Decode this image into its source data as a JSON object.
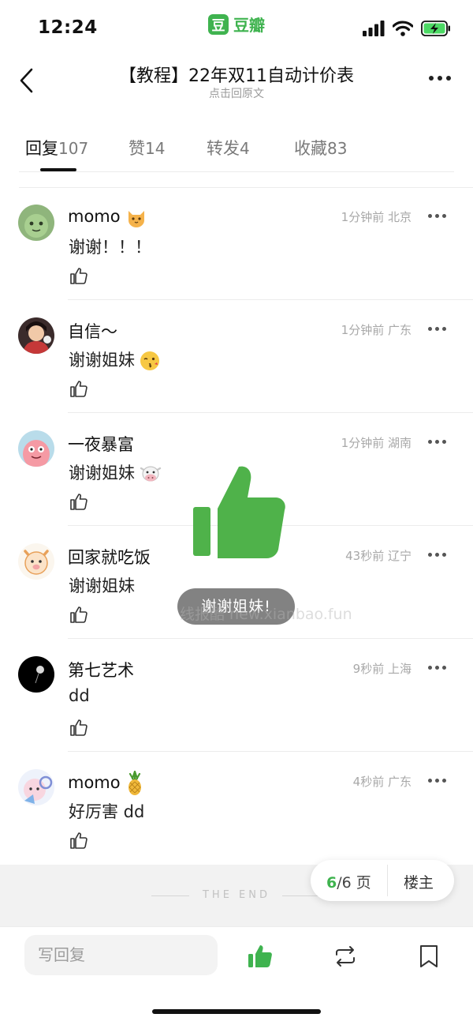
{
  "status": {
    "time": "12:24",
    "brand_logo": "豆",
    "brand_name": "豆瓣"
  },
  "header": {
    "title": "【教程】22年双11自动计价表",
    "subtitle": "点击回原文"
  },
  "tabs": [
    {
      "label": "回复",
      "count": "107"
    },
    {
      "label": "赞",
      "count": "14"
    },
    {
      "label": "转发",
      "count": "4"
    },
    {
      "label": "收藏",
      "count": "83"
    }
  ],
  "comments": [
    {
      "username": "momo",
      "time": "1分钟前",
      "location": "北京",
      "text": "谢谢！！！",
      "badge_icon": "cat-emoji-icon"
    },
    {
      "username": "自信～",
      "time": "1分钟前",
      "location": "广东",
      "text": "谢谢姐妹",
      "text_emoji": "kiss-face-emoji-icon"
    },
    {
      "username": "一夜暴富",
      "time": "1分钟前",
      "location": "湖南",
      "text": "谢谢姐妹",
      "text_emoji": "cow-face-emoji-icon"
    },
    {
      "username": "回家就吃饭",
      "time": "43秒前",
      "location": "辽宁",
      "text": "谢谢姐妹"
    },
    {
      "username": "第七艺术",
      "time": "9秒前",
      "location": "上海",
      "text": "dd"
    },
    {
      "username": "momo",
      "time": "4秒前",
      "location": "广东",
      "text": "好厉害 dd",
      "badge_icon": "pineapple-emoji-icon"
    }
  ],
  "end_text": "THE END",
  "pager": {
    "current": "6",
    "total_text": "/6 页",
    "owner_label": "楼主"
  },
  "bottom": {
    "reply_placeholder": "写回复"
  },
  "toast": {
    "text": "谢谢姐妹!"
  },
  "watermark": "线报酷 new.xianbao.fun",
  "colors": {
    "accent": "#3fb34f"
  }
}
